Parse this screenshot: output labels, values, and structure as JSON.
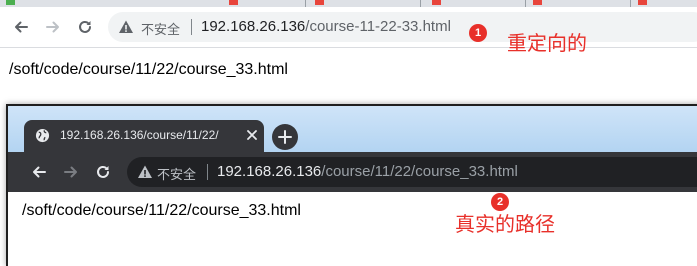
{
  "top_browser": {
    "insecure_label": "不安全",
    "url_host": "192.168.26.136",
    "url_path": "/course-11-22-33.html",
    "page_text": "/soft/code/course/11/22/course_33.html",
    "icons": [
      "back-arrow-icon",
      "forward-arrow-icon",
      "reload-icon",
      "warning-icon"
    ]
  },
  "inner_browser": {
    "tab_title": "192.168.26.136/course/11/22/",
    "insecure_label": "不安全",
    "url_host": "192.168.26.136",
    "url_path": "/course/11/22/course_33.html",
    "page_text": "/soft/code/course/11/22/course_33.html",
    "icons": [
      "globe-icon",
      "close-icon",
      "plus-icon",
      "back-arrow-icon",
      "forward-arrow-icon",
      "reload-icon",
      "warning-icon"
    ]
  },
  "annotations": [
    {
      "badge": "1",
      "text": "重定向的"
    },
    {
      "badge": "2",
      "text": "真实的路径"
    }
  ],
  "colors": {
    "annotation_red": "#e8302a",
    "dark_chrome": "#35363a",
    "dark_omnibox": "#202124",
    "light_omnibox": "#f1f3f4",
    "tabstrip_blue": "#b3d4f2"
  }
}
